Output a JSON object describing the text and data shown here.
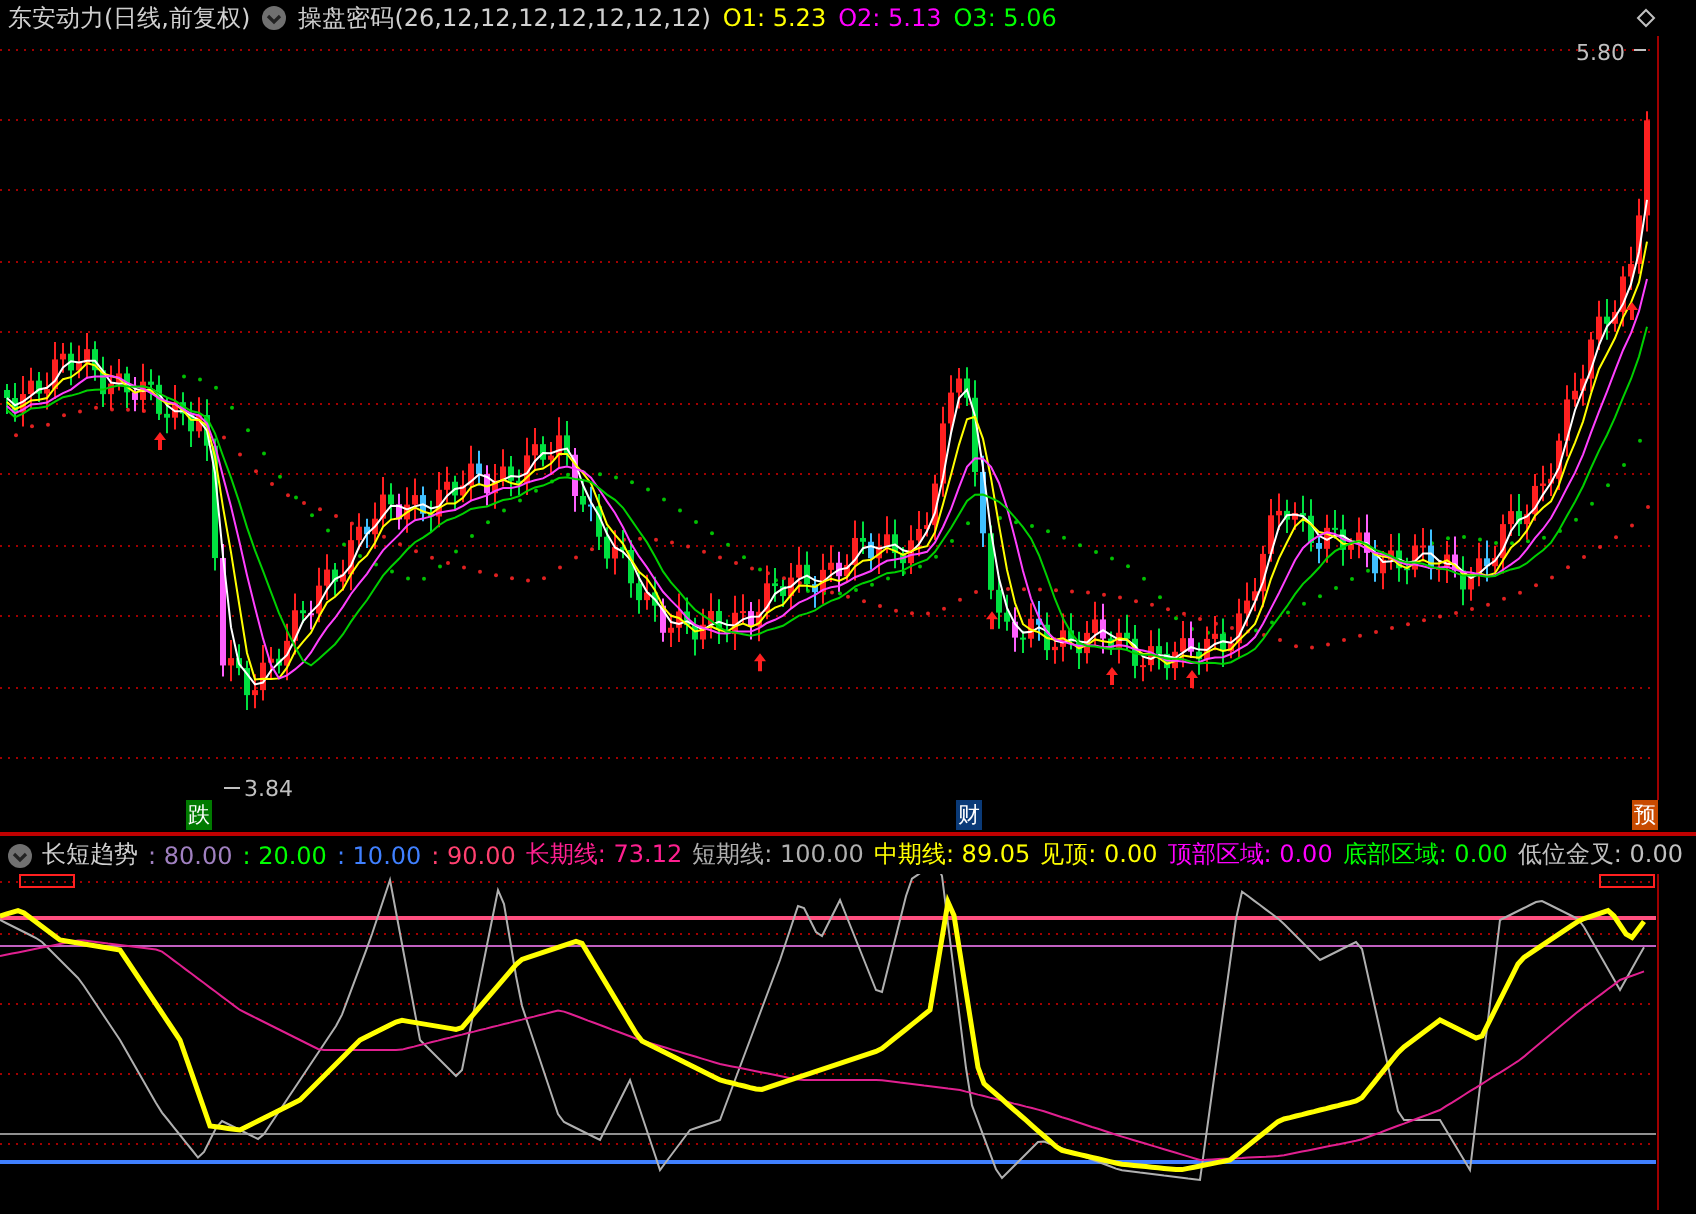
{
  "header": {
    "stock": "东安动力(日线,前复权)",
    "indicator": "操盘密码(26,12,12,12,12,12,12,12)",
    "values": [
      {
        "label": "O1:",
        "value": "5.23",
        "color": "#ffff00"
      },
      {
        "label": "O2:",
        "value": "5.13",
        "color": "#ff00ff"
      },
      {
        "label": "O3:",
        "value": "5.06",
        "color": "#00ff00"
      }
    ]
  },
  "price_chart": {
    "high_label": "5.80",
    "low_label": "3.84",
    "markers": [
      {
        "text": "跌",
        "color": "#007a00"
      },
      {
        "text": "财",
        "color": "#0a3a78"
      },
      {
        "text": "预",
        "color": "#c84a00"
      }
    ]
  },
  "lower": {
    "title": "长短趋势",
    "values": [
      {
        "label": ":",
        "value": "80.00",
        "color": "#a080c0"
      },
      {
        "label": ":",
        "value": "20.00",
        "color": "#00ff00"
      },
      {
        "label": ":",
        "value": "10.00",
        "color": "#4080ff"
      },
      {
        "label": ":",
        "value": "90.00",
        "color": "#ff4070"
      },
      {
        "label": "长期线:",
        "value": "73.12",
        "color": "#ff2090"
      },
      {
        "label": "短期线:",
        "value": "100.00",
        "color": "#b0b0b0"
      },
      {
        "label": "中期线:",
        "value": "89.05",
        "color": "#ffff00"
      },
      {
        "label": "见顶:",
        "value": "0.00",
        "color": "#ffff00"
      },
      {
        "label": "顶部区域:",
        "value": "0.00",
        "color": "#ff00ff"
      },
      {
        "label": "底部区域:",
        "value": "0.00",
        "color": "#00ff00"
      },
      {
        "label": "低位金叉:",
        "value": "0.00",
        "color": "#c0c0c0"
      }
    ]
  }
}
